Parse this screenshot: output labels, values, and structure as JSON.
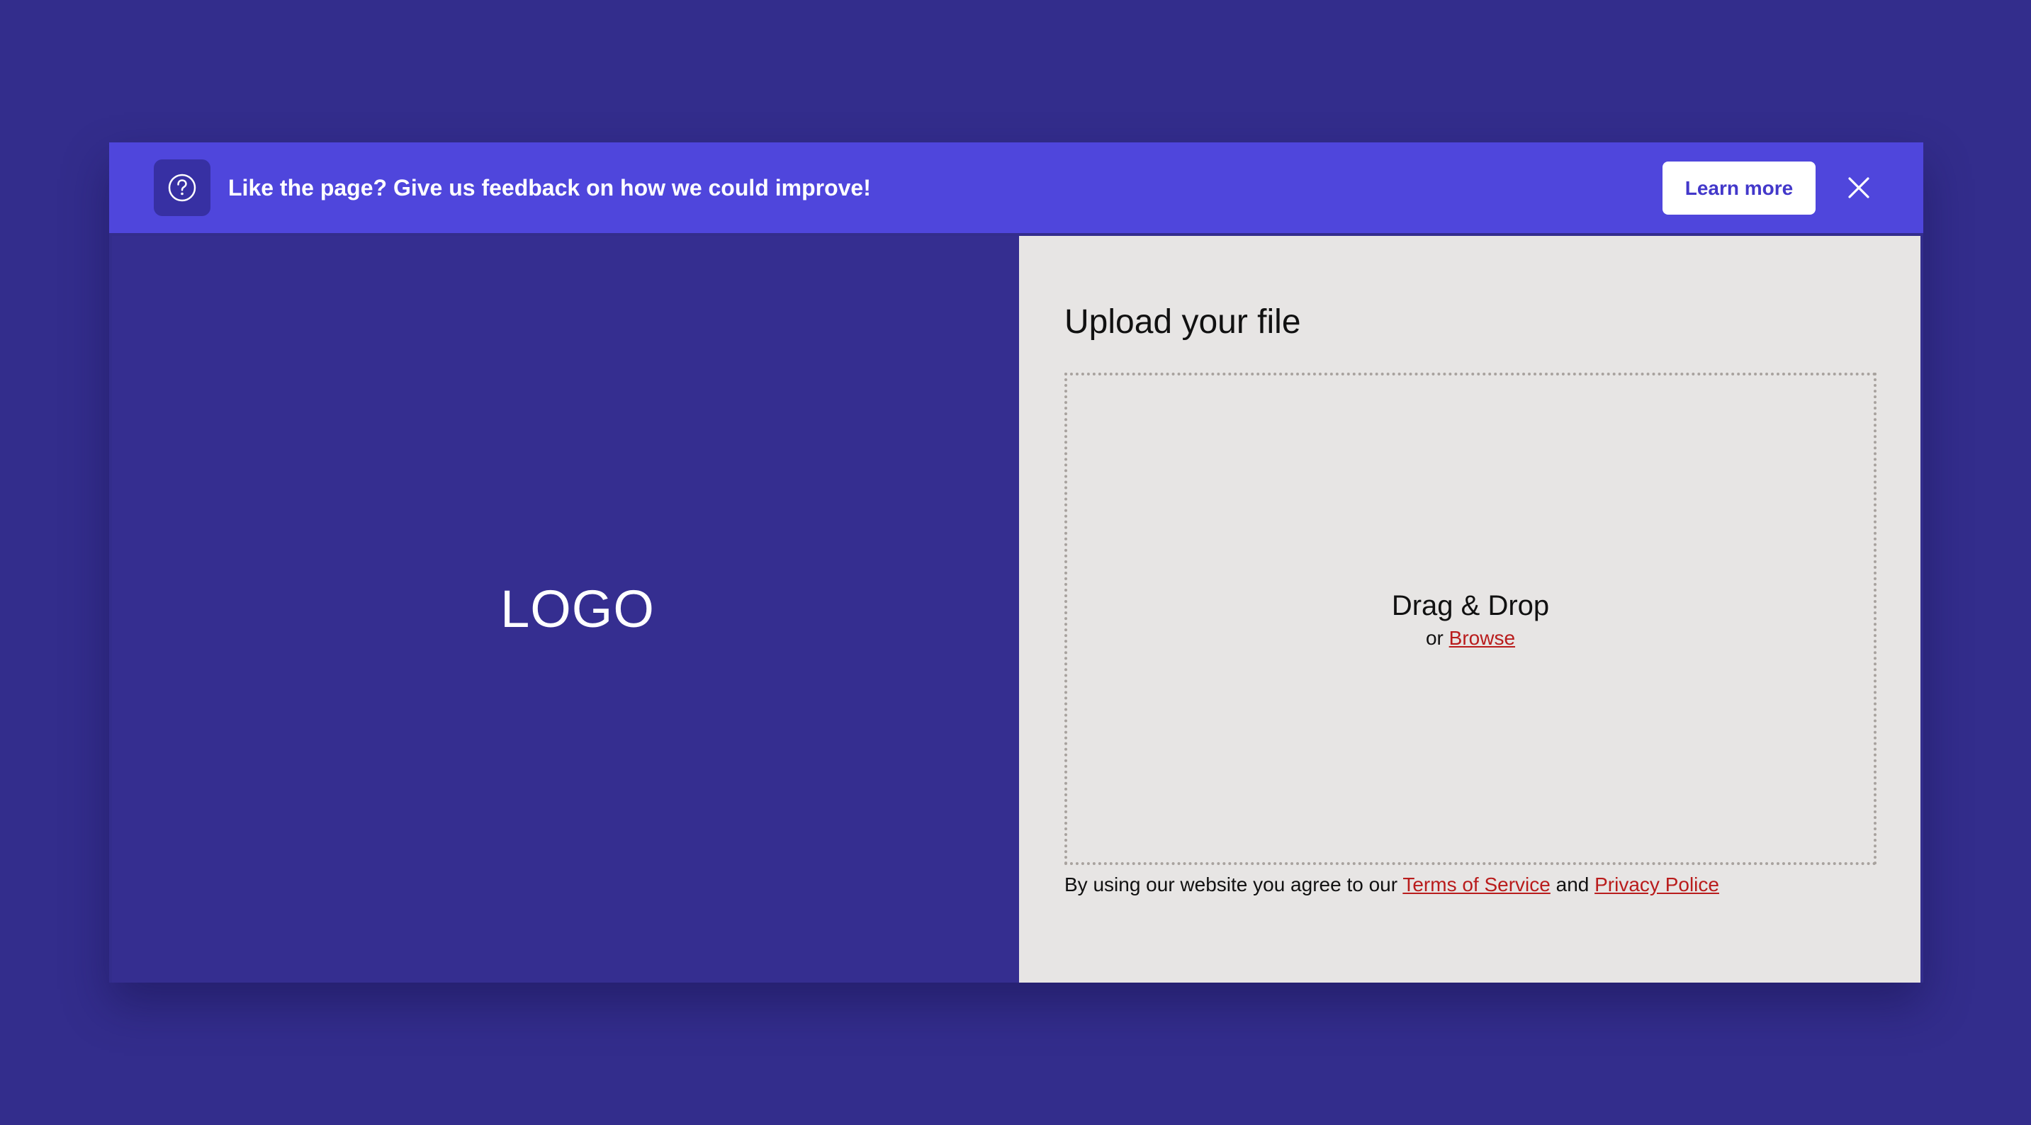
{
  "banner": {
    "message": "Like the page? Give us feedback on how we could improve!",
    "icon": "question-circle-icon",
    "learn_more_label": "Learn more",
    "close_icon": "close-icon"
  },
  "left_panel": {
    "logo_text": "LOGO"
  },
  "upload": {
    "title": "Upload your file",
    "dropzone_title": "Drag & Drop",
    "or_text": "or",
    "browse_label": "Browse"
  },
  "terms": {
    "prefix": "By using our website you agree to our",
    "terms_label": "Terms of Service",
    "and_text": "and",
    "privacy_label": "Privacy Police"
  },
  "colors": {
    "page_background": "#332d8c",
    "banner_background": "#4f46dc",
    "icon_background": "#3730a3",
    "left_panel_background": "#352e90",
    "right_panel_background": "#e7e5e4",
    "link": "#b91c1c",
    "button_text": "#4338ca"
  }
}
